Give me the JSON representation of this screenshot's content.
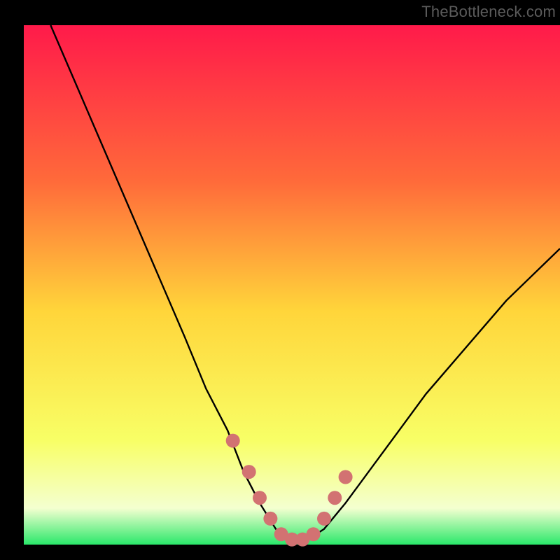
{
  "attribution": "TheBottleneck.com",
  "colors": {
    "black": "#000000",
    "curve": "#000000",
    "marker": "#d27272",
    "grad_top": "#ff1a4a",
    "grad_mid1": "#ff6a3a",
    "grad_mid2": "#ffd53a",
    "grad_lower": "#f8ff66",
    "grad_pale": "#f4ffd0",
    "grad_green": "#2ae86a"
  },
  "chart_data": {
    "type": "line",
    "title": "",
    "xlabel": "",
    "ylabel": "",
    "xlim": [
      0,
      100
    ],
    "ylim": [
      0,
      100
    ],
    "series": [
      {
        "name": "bottleneck-curve",
        "x": [
          5,
          10,
          15,
          20,
          25,
          30,
          34,
          38,
          41,
          44,
          47,
          50,
          53,
          56,
          60,
          65,
          70,
          75,
          80,
          85,
          90,
          95,
          100
        ],
        "values": [
          100,
          88,
          76,
          64,
          52,
          40,
          30,
          22,
          14,
          8,
          3,
          1,
          1,
          3,
          8,
          15,
          22,
          29,
          35,
          41,
          47,
          52,
          57
        ]
      }
    ],
    "markers": {
      "name": "highlight-points",
      "x": [
        39,
        42,
        44,
        46,
        48,
        50,
        52,
        54,
        56,
        58,
        60
      ],
      "values": [
        20,
        14,
        9,
        5,
        2,
        1,
        1,
        2,
        5,
        9,
        13
      ]
    }
  }
}
